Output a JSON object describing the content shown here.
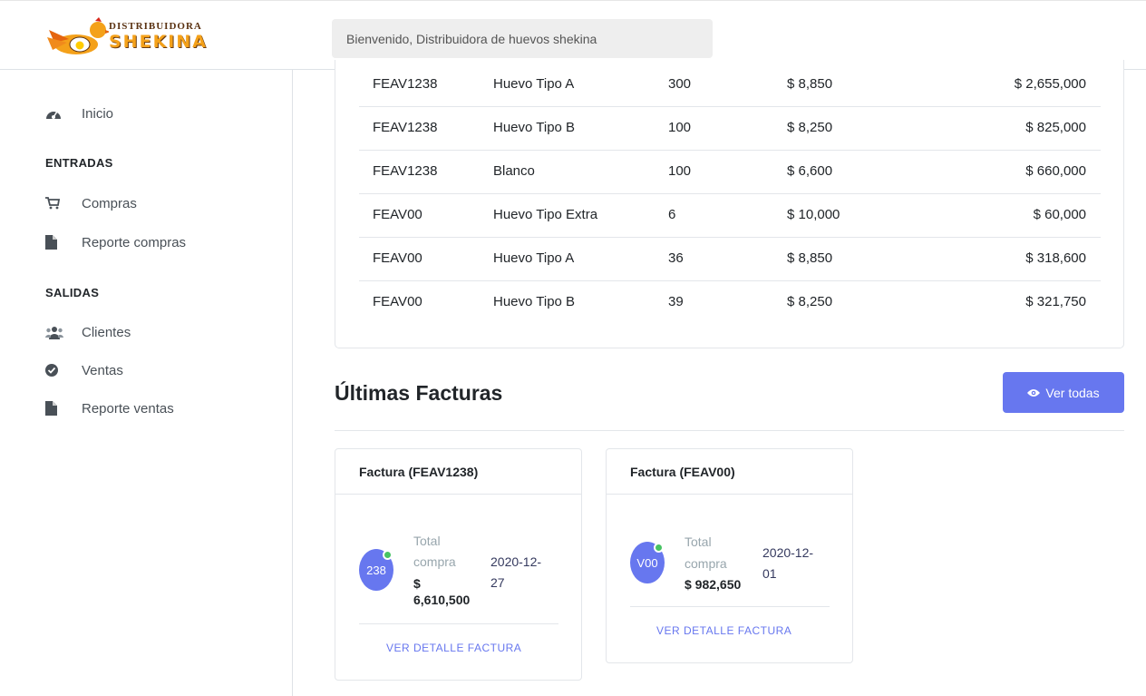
{
  "header": {
    "logo_top": "Distribuidora",
    "logo_main": "Shekina",
    "welcome": "Bienvenido, Distribuidora de huevos shekina"
  },
  "sidebar": {
    "inicio": "Inicio",
    "entradas_head": "ENTRADAS",
    "compras": "Compras",
    "reporte_compras": "Reporte compras",
    "salidas_head": "SALIDAS",
    "clientes": "Clientes",
    "ventas": "Ventas",
    "reporte_ventas": "Reporte ventas"
  },
  "table": {
    "rows": [
      {
        "factura": "FEAV1238",
        "producto": "Huevo Tipo A",
        "cantidad": "300",
        "precio": "$ 8,850",
        "total": "$ 2,655,000"
      },
      {
        "factura": "FEAV1238",
        "producto": "Huevo Tipo B",
        "cantidad": "100",
        "precio": "$ 8,250",
        "total": "$ 825,000"
      },
      {
        "factura": "FEAV1238",
        "producto": "Blanco",
        "cantidad": "100",
        "precio": "$ 6,600",
        "total": "$ 660,000"
      },
      {
        "factura": "FEAV00",
        "producto": "Huevo Tipo Extra",
        "cantidad": "6",
        "precio": "$ 10,000",
        "total": "$ 60,000"
      },
      {
        "factura": "FEAV00",
        "producto": "Huevo Tipo A",
        "cantidad": "36",
        "precio": "$ 8,850",
        "total": "$ 318,600"
      },
      {
        "factura": "FEAV00",
        "producto": "Huevo Tipo B",
        "cantidad": "39",
        "precio": "$ 8,250",
        "total": "$ 321,750"
      }
    ]
  },
  "facturas": {
    "title": "Últimas Facturas",
    "ver_todas": "Ver todas",
    "cards": [
      {
        "header": "Factura (FEAV1238)",
        "avatar": "238",
        "label1": "Total",
        "label2": "compra",
        "amount1": "$",
        "amount2": "6,610,500",
        "date1": "2020-12-",
        "date2": "27",
        "link": "VER DETALLE FACTURA"
      },
      {
        "header": "Factura (FEAV00)",
        "avatar": "V00",
        "label1": "Total",
        "label2": "compra",
        "amount": "$ 982,650",
        "date1": "2020-12-",
        "date2": "01",
        "link": "VER DETALLE FACTURA"
      }
    ]
  },
  "colors": {
    "primary": "#6777ef",
    "online": "#47c363",
    "logo_orange": "#f4a11a"
  }
}
